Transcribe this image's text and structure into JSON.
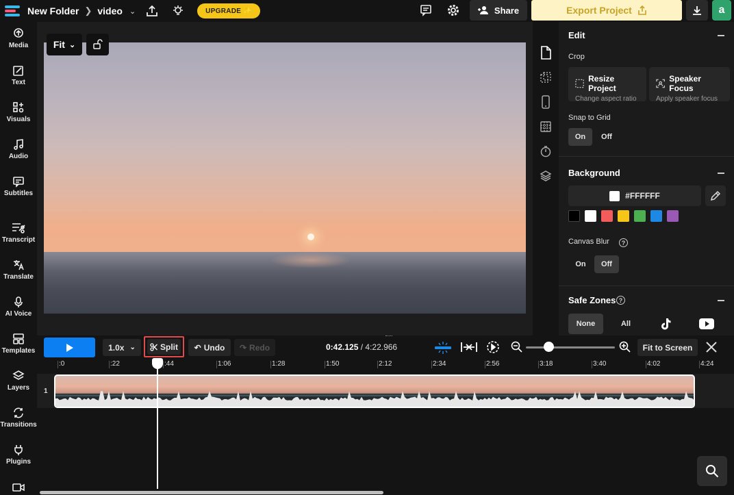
{
  "header": {
    "folder": "New Folder",
    "project": "video",
    "upgrade_label": "UPGRADE ✨",
    "share_label": "Share",
    "export_label": "Export Project",
    "avatar_letter": "a"
  },
  "sidebar": {
    "items": [
      {
        "label": "Media",
        "icon": "upload-cloud-icon"
      },
      {
        "label": "Text",
        "icon": "text-edit-icon"
      },
      {
        "label": "Visuals",
        "icon": "shapes-icon"
      },
      {
        "label": "Audio",
        "icon": "music-note-icon"
      },
      {
        "label": "Subtitles",
        "icon": "subtitles-icon"
      },
      {
        "label": "Transcript",
        "icon": "transcript-icon"
      },
      {
        "label": "Translate",
        "icon": "translate-icon"
      },
      {
        "label": "AI Voice",
        "icon": "microphone-icon"
      },
      {
        "label": "Templates",
        "icon": "templates-icon"
      },
      {
        "label": "Layers",
        "icon": "layers-icon"
      },
      {
        "label": "Transitions",
        "icon": "transitions-icon"
      },
      {
        "label": "Plugins",
        "icon": "plug-icon"
      }
    ]
  },
  "canvas": {
    "fit_label": "Fit"
  },
  "panel": {
    "edit_title": "Edit",
    "crop_label": "Crop",
    "resize_title": "Resize Project",
    "resize_sub": "Change aspect ratio",
    "speaker_title": "Speaker Focus",
    "speaker_sub": "Apply speaker focus",
    "snap_label": "Snap to Grid",
    "snap_on": "On",
    "snap_off": "Off",
    "snap_selected": "On",
    "background_title": "Background",
    "background_color": "#FFFFFF",
    "swatches": [
      "#000000",
      "#ffffff",
      "#f45b5b",
      "#f5c518",
      "#4caf50",
      "#1e88e5",
      "#9b59b6"
    ],
    "blur_label": "Canvas Blur",
    "blur_on": "On",
    "blur_off": "Off",
    "blur_selected": "Off",
    "safe_zones_title": "Safe Zones",
    "safe_none": "None",
    "safe_all": "All"
  },
  "timeline": {
    "speed": "1.0x",
    "split_label": "Split",
    "undo_label": "Undo",
    "redo_label": "Redo",
    "current_time": "0:42.125",
    "total_time": "4:22.966",
    "fit_screen_label": "Fit to Screen",
    "track_number": "1",
    "ruler": [
      ":0",
      ":22",
      ":44",
      "1:06",
      "1:28",
      "1:50",
      "2:12",
      "2:34",
      "2:56",
      "3:18",
      "3:40",
      "4:02",
      "4:24"
    ]
  },
  "colors": {
    "accent_blue": "#0c7ff2",
    "export_bg": "#fdf3c5",
    "export_text": "#c9a326",
    "upgrade_bg": "#f5c518",
    "highlight_red": "#e34b4b",
    "avatar_bg": "#2fa36b"
  }
}
